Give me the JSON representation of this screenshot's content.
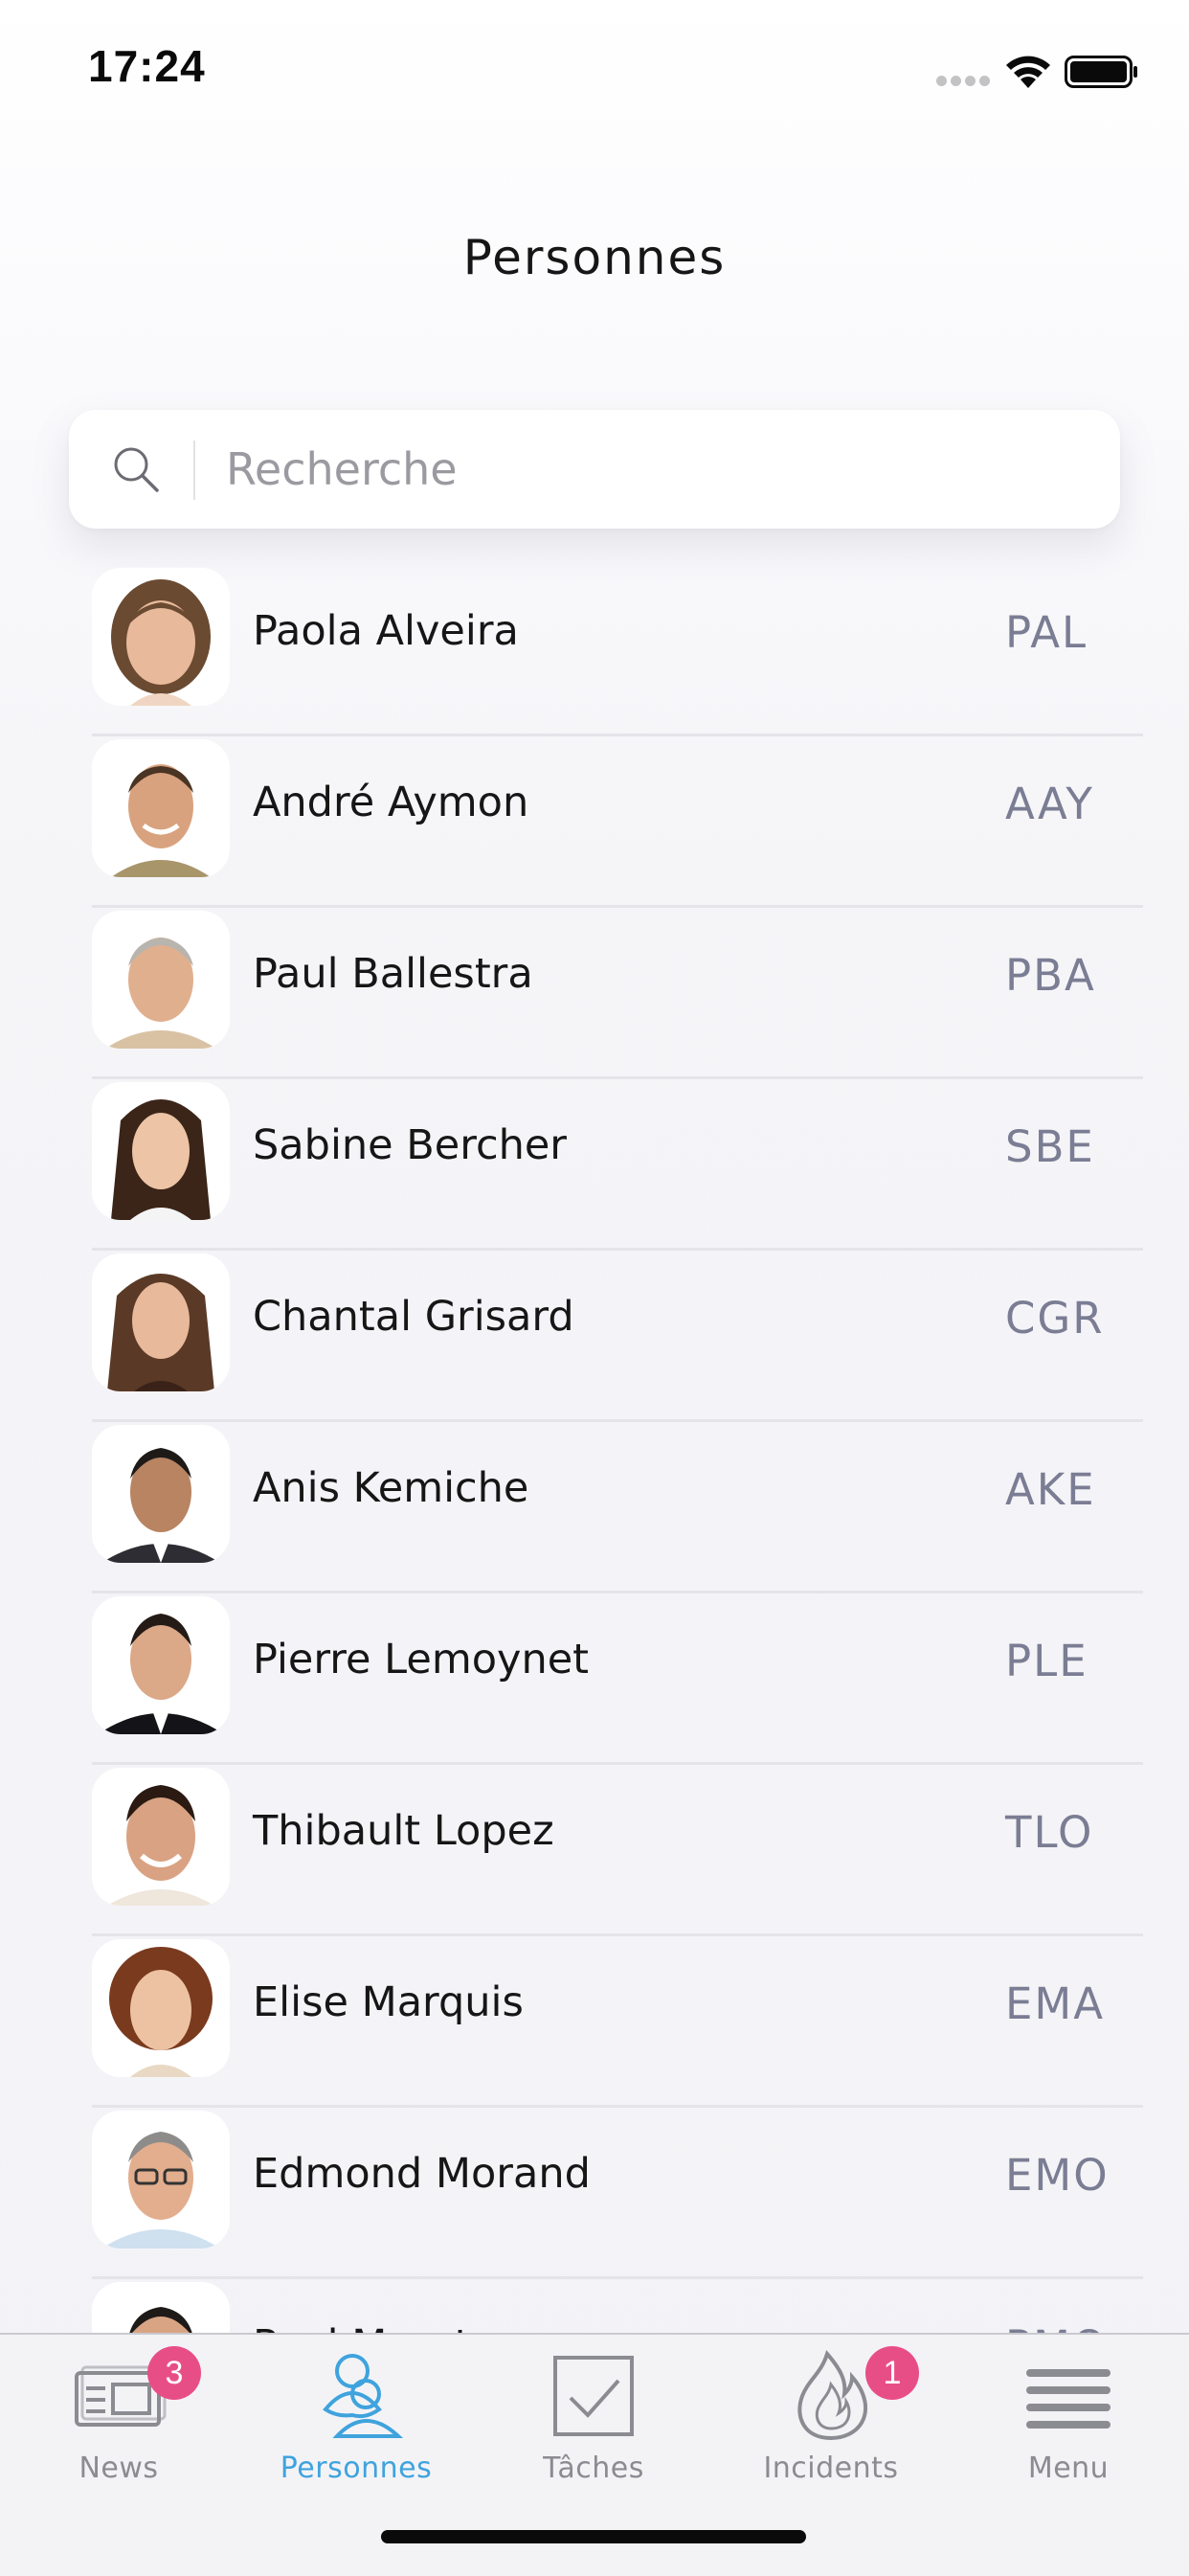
{
  "status_bar": {
    "time": "17:24"
  },
  "header": {
    "title": "Personnes"
  },
  "search": {
    "placeholder": "Recherche",
    "value": ""
  },
  "people": [
    {
      "name": "Paola Alveira",
      "code": "PAL",
      "avatar": "woman-short-brown-hair"
    },
    {
      "name": "André Aymon",
      "code": "AAY",
      "avatar": "man-smiling"
    },
    {
      "name": "Paul Ballestra",
      "code": "PBA",
      "avatar": "man-grey-hair"
    },
    {
      "name": "Sabine Bercher",
      "code": "SBE",
      "avatar": "woman-dark-hair"
    },
    {
      "name": "Chantal Grisard",
      "code": "CGR",
      "avatar": "woman-brown-hair"
    },
    {
      "name": "Anis Kemiche",
      "code": "AKE",
      "avatar": "man-suit-curly-hair"
    },
    {
      "name": "Pierre Lemoynet",
      "code": "PLE",
      "avatar": "man-suit-dark-hair"
    },
    {
      "name": "Thibault Lopez",
      "code": "TLO",
      "avatar": "man-dark-hair-smiling"
    },
    {
      "name": "Elise Marquis",
      "code": "EMA",
      "avatar": "woman-curly-red-hair"
    },
    {
      "name": "Edmond Morand",
      "code": "EMO",
      "avatar": "man-glasses"
    },
    {
      "name": "Paul Morat",
      "code": "PMO",
      "avatar": "man-short-hair"
    }
  ],
  "tab_bar": {
    "tabs": [
      {
        "label": "News",
        "icon": "newspaper-icon",
        "badge": "3",
        "active": false
      },
      {
        "label": "Personnes",
        "icon": "people-icon",
        "badge": "",
        "active": true
      },
      {
        "label": "Tâches",
        "icon": "checkbox-icon",
        "badge": "",
        "active": false
      },
      {
        "label": "Incidents",
        "icon": "flame-icon",
        "badge": "1",
        "active": false
      },
      {
        "label": "Menu",
        "icon": "hamburger-menu-icon",
        "badge": "",
        "active": false
      }
    ]
  },
  "colors": {
    "accent": "#3fa3dd",
    "badge": "#e84e86",
    "code_text": "#7a7d93",
    "inactive_tab": "#8b8b92"
  }
}
